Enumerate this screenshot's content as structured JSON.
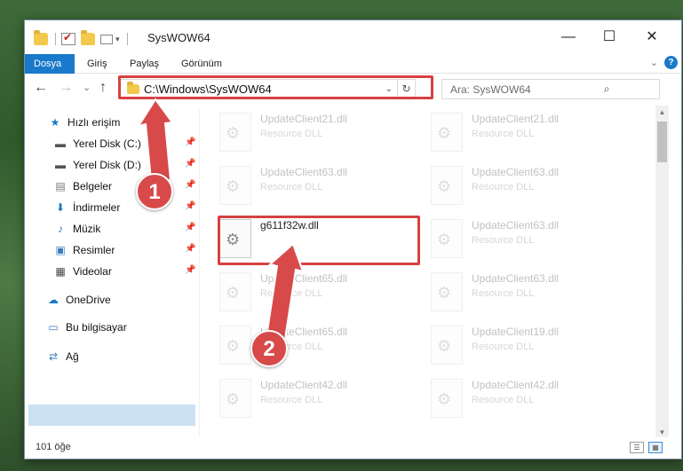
{
  "window": {
    "title": "SysWOW64",
    "minimize_glyph": "—",
    "maximize_glyph": "☐",
    "close_glyph": "✕"
  },
  "ribbon": {
    "tabs": [
      {
        "label": "Dosya",
        "active": true
      },
      {
        "label": "Giriş"
      },
      {
        "label": "Paylaş"
      },
      {
        "label": "Görünüm"
      }
    ],
    "expand_glyph": "⌄",
    "help_glyph": "?"
  },
  "nav": {
    "back_glyph": "←",
    "forward_glyph": "→",
    "recent_glyph": "⌄",
    "up_glyph": "↑",
    "address_path": "C:\\Windows\\SysWOW64",
    "address_dropdown_glyph": "⌄",
    "refresh_glyph": "↻",
    "search_placeholder": "Ara: SysWOW64",
    "search_glyph": "⌕"
  },
  "sidebar": {
    "quick_access": "Hızlı erişim",
    "items": [
      {
        "label": "Yerel Disk (C:)",
        "icon": "drive-icon",
        "pinned": true
      },
      {
        "label": "Yerel Disk (D:)",
        "icon": "drive-icon",
        "pinned": true
      },
      {
        "label": "Belgeler",
        "icon": "documents-icon",
        "pinned": true
      },
      {
        "label": "İndirmeler",
        "icon": "download-icon",
        "pinned": true
      },
      {
        "label": "Müzik",
        "icon": "music-icon",
        "pinned": true
      },
      {
        "label": "Resimler",
        "icon": "pictures-icon",
        "pinned": true
      },
      {
        "label": "Videolar",
        "icon": "videos-icon",
        "pinned": true
      }
    ],
    "onedrive": "OneDrive",
    "this_pc": "Bu bilgisayar",
    "network": "Ağ"
  },
  "files": {
    "left": [
      {
        "name": "UpdateClient21.dll",
        "type": "Resource DLL",
        "faded": true
      },
      {
        "name": "UpdateClient63.dll",
        "type": "Resource DLL",
        "faded": true
      },
      {
        "name": "g611f32w.dll",
        "type": "",
        "faded": false
      },
      {
        "name": "UpdateClient65.dll",
        "type": "Resource DLL",
        "faded": true
      },
      {
        "name": "UpdateClient65.dll",
        "type": "Resource DLL",
        "faded": true
      },
      {
        "name": "UpdateClient42.dll",
        "type": "Resource DLL",
        "faded": true
      }
    ],
    "right": [
      {
        "name": "UpdateClient21.dll",
        "type": "Resource DLL",
        "faded": true
      },
      {
        "name": "UpdateClient63.dll",
        "type": "Resource DLL",
        "faded": true
      },
      {
        "name": "UpdateClient63.dll",
        "type": "Resource DLL",
        "faded": true
      },
      {
        "name": "UpdateClient63.dll",
        "type": "Resource DLL",
        "faded": true
      },
      {
        "name": "UpdateClient19.dll",
        "type": "Resource DLL",
        "faded": true
      },
      {
        "name": "UpdateClient42.dll",
        "type": "Resource DLL",
        "faded": true
      }
    ]
  },
  "status": {
    "item_count": "101 öğe"
  },
  "annotations": {
    "step1": "1",
    "step2": "2",
    "color": "#d84a4a"
  }
}
